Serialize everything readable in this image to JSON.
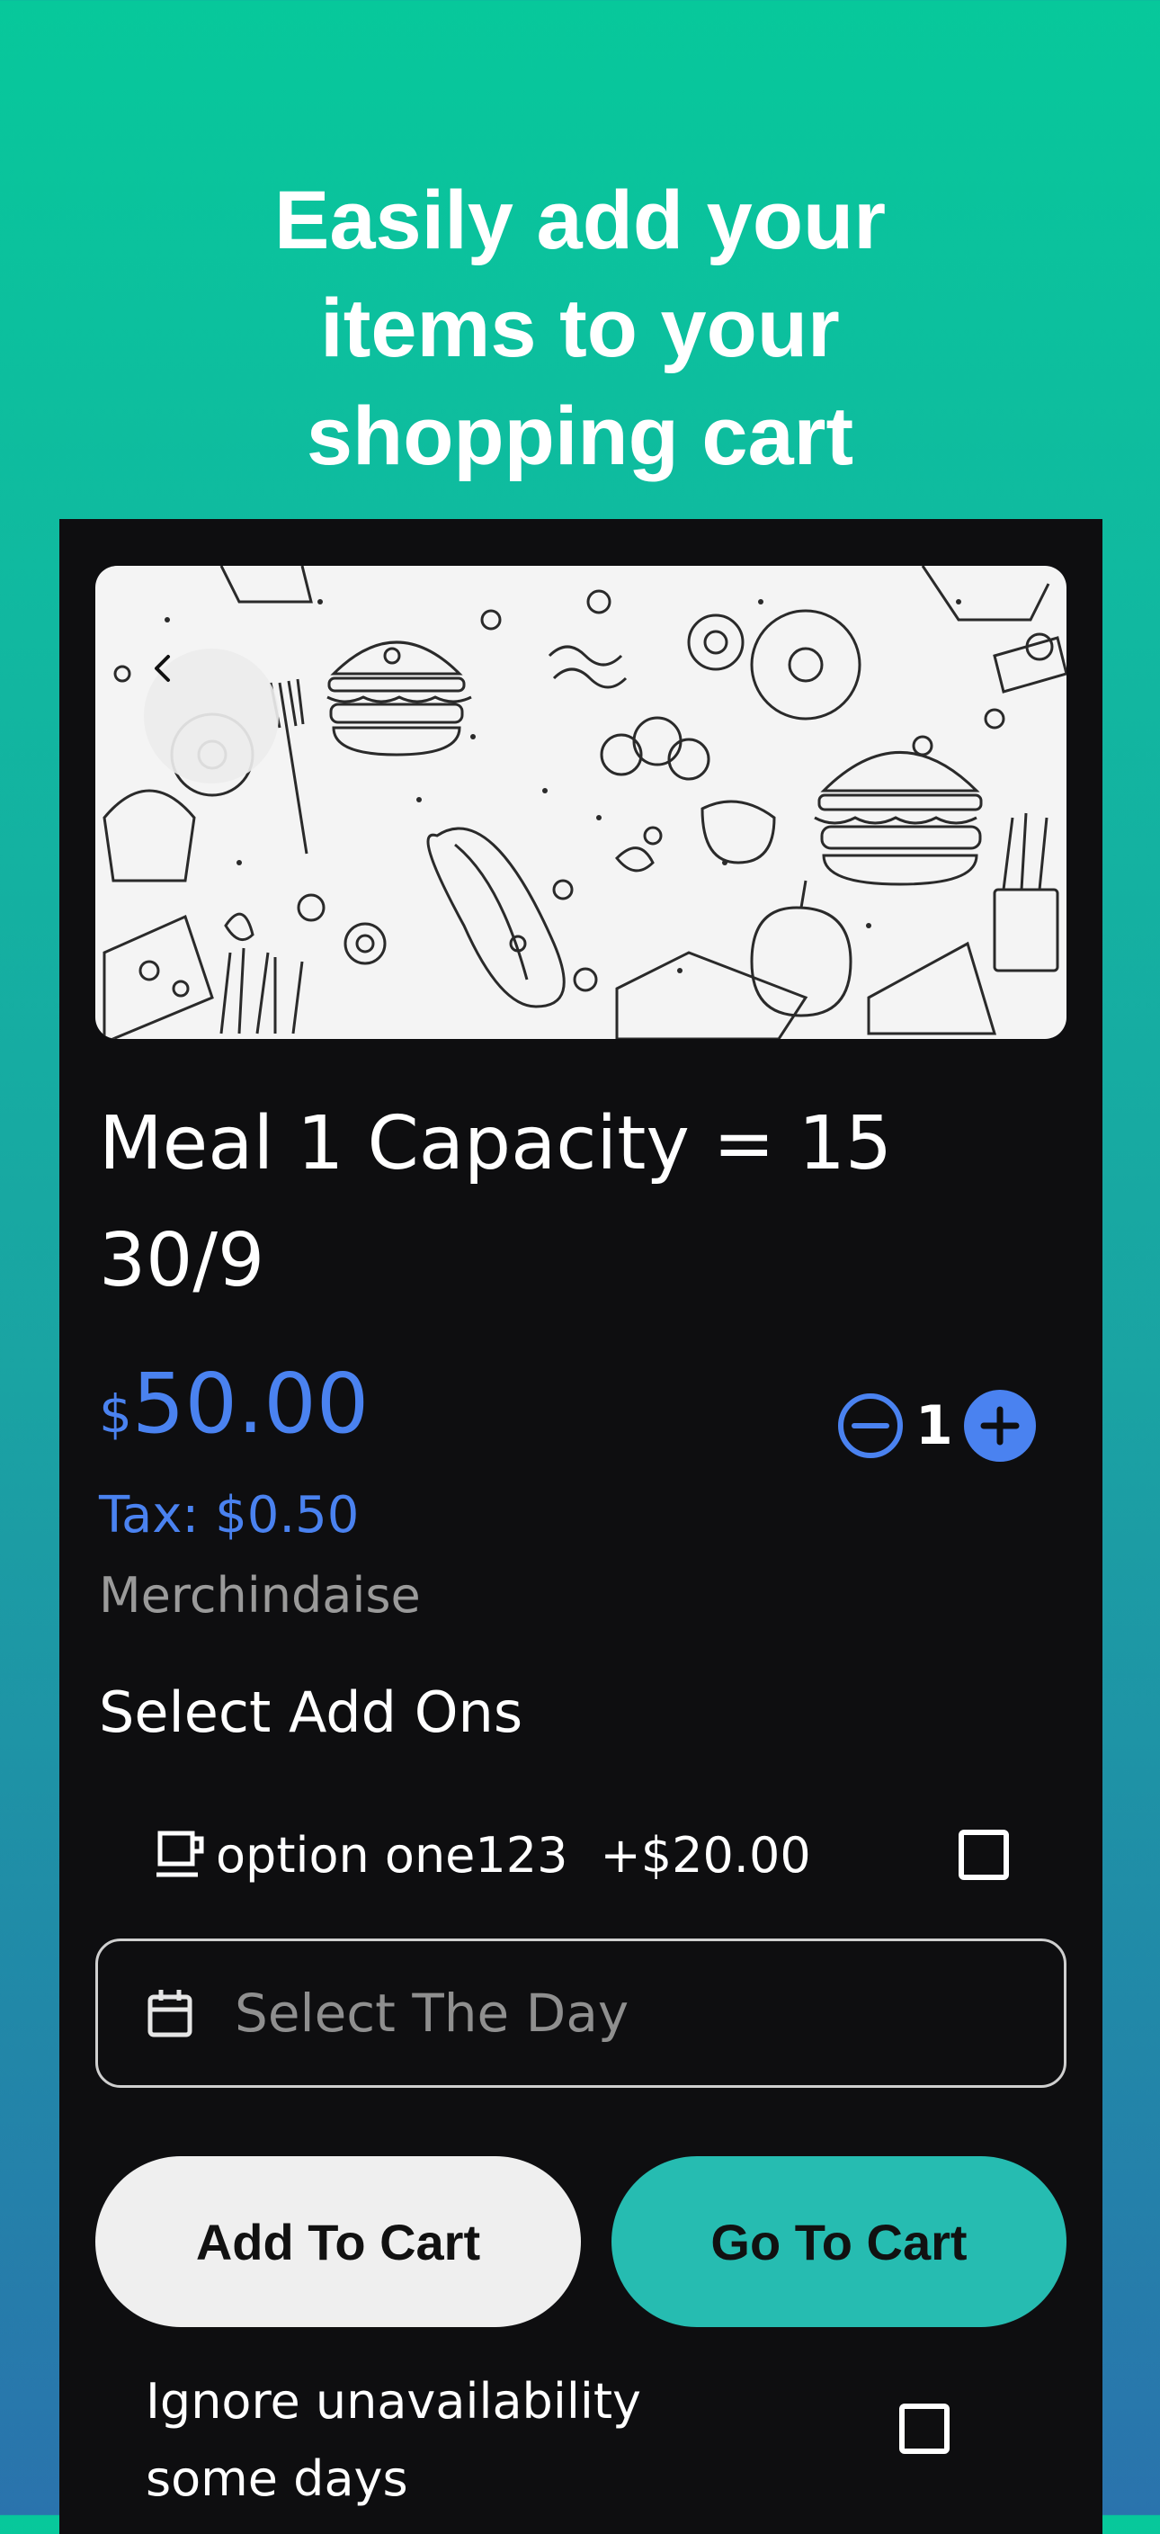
{
  "promo": {
    "headline_line1": "Easily add your",
    "headline_line2": "items to your",
    "headline_line3": "shopping cart"
  },
  "product": {
    "title_line1": "Meal 1 Capacity = 15",
    "title_line2": "30/9",
    "currency": "$",
    "price": "50.00",
    "tax": "Tax: $0.50",
    "category": "Merchindaise",
    "quantity": "1"
  },
  "addons": {
    "label": "Select Add Ons",
    "options": [
      {
        "name": "option one123",
        "price": "+$20.00",
        "icon": "mug-icon",
        "checked": false
      }
    ]
  },
  "day_select": {
    "placeholder": "Select The Day",
    "icon": "calendar-icon"
  },
  "actions": {
    "add_to_cart": "Add To Cart",
    "go_to_cart": "Go To Cart"
  },
  "ignore_unavailability": {
    "line1": "Ignore unavailability",
    "line2": "some days",
    "checked": false
  },
  "colors": {
    "accent_blue": "#4a82f0",
    "go_button": "#26bcb1",
    "gradient_top": "#07c89b",
    "gradient_bottom": "#2a73ad",
    "screen_bg": "#0e0e10"
  }
}
